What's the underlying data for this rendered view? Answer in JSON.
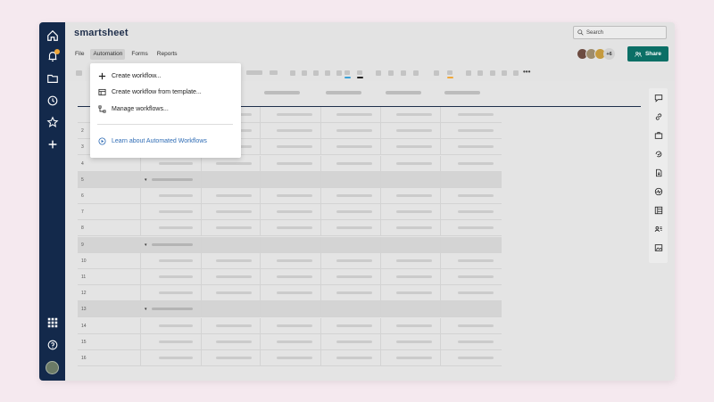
{
  "app": {
    "logo": "smartsheet"
  },
  "search": {
    "placeholder": "Search"
  },
  "menubar": {
    "items": [
      "File",
      "Automation",
      "Forms",
      "Reports"
    ],
    "active": "Automation"
  },
  "collaborators": {
    "more_count": "+6"
  },
  "share": {
    "label": "Share",
    "color": "#0b6f66"
  },
  "automation_menu": {
    "items": [
      {
        "label": "Create workflow...",
        "icon": "plus-icon"
      },
      {
        "label": "Create workflow from template...",
        "icon": "template-icon"
      },
      {
        "label": "Manage workflows...",
        "icon": "workflow-icon"
      }
    ],
    "learn_link": {
      "label": "Learn about Automated Workflows",
      "icon": "play-icon",
      "color": "#2f6cb5"
    }
  },
  "grid": {
    "rows": [
      {
        "num": "",
        "group": false
      },
      {
        "num": "2",
        "group": false
      },
      {
        "num": "3",
        "group": false
      },
      {
        "num": "4",
        "group": false
      },
      {
        "num": "5",
        "group": true
      },
      {
        "num": "6",
        "group": false
      },
      {
        "num": "7",
        "group": false
      },
      {
        "num": "8",
        "group": false
      },
      {
        "num": "9",
        "group": true
      },
      {
        "num": "10",
        "group": false
      },
      {
        "num": "11",
        "group": false
      },
      {
        "num": "12",
        "group": false
      },
      {
        "num": "13",
        "group": true
      },
      {
        "num": "14",
        "group": false
      },
      {
        "num": "15",
        "group": false
      },
      {
        "num": "16",
        "group": false
      }
    ]
  },
  "colors": {
    "nav": "#13294b",
    "accent_line": "#1f2f4b",
    "notification_badge": "#f0a83a"
  }
}
